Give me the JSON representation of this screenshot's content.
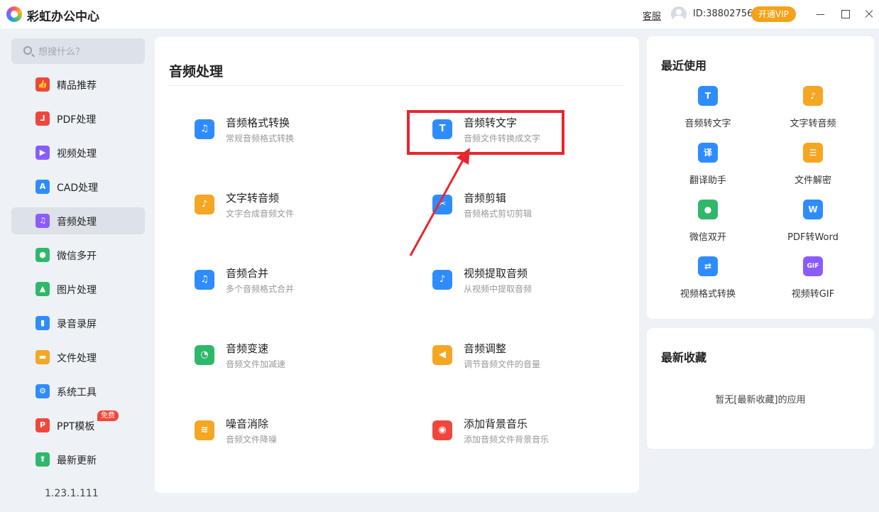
{
  "app": {
    "title": "彩虹办公中心",
    "service_label": "客服",
    "user_id": "ID:38802756",
    "vip_label": "开通VIP"
  },
  "search": {
    "placeholder": "想搜什么？"
  },
  "sidebar": {
    "items": [
      {
        "label": "精品推荐",
        "icon": "thumbs-up-icon",
        "color": "#f0473c"
      },
      {
        "label": "PDF处理",
        "icon": "pdf-icon",
        "color": "#f0473c"
      },
      {
        "label": "视频处理",
        "icon": "video-play-icon",
        "color": "#8a5cff"
      },
      {
        "label": "CAD处理",
        "icon": "cad-icon",
        "color": "#2f8cff"
      },
      {
        "label": "音频处理",
        "icon": "music-note-icon",
        "color": "#8a5cff"
      },
      {
        "label": "微信多开",
        "icon": "wechat-icon",
        "color": "#2fb86a"
      },
      {
        "label": "图片处理",
        "icon": "image-icon",
        "color": "#2fb86a"
      },
      {
        "label": "录音录屏",
        "icon": "microphone-icon",
        "color": "#2f8cff"
      },
      {
        "label": "文件处理",
        "icon": "folder-icon",
        "color": "#f5a623"
      },
      {
        "label": "系统工具",
        "icon": "gear-icon",
        "color": "#2f8cff"
      },
      {
        "label": "PPT模板",
        "icon": "ppt-icon",
        "color": "#f0473c",
        "badge": "免费"
      },
      {
        "label": "最新更新",
        "icon": "upload-icon",
        "color": "#2fb86a"
      }
    ],
    "version": "1.23.1.111"
  },
  "main": {
    "title": "音频处理",
    "tools": [
      {
        "name": "音频格式转换",
        "desc": "常规音频格式转换",
        "icon": "audio-convert-icon",
        "color": "#2f8cff"
      },
      {
        "name": "音频转文字",
        "desc": "音频文件转换成文字",
        "icon": "audio-to-text-icon",
        "color": "#2f8cff"
      },
      {
        "name": "文字转音频",
        "desc": "文字合成音频文件",
        "icon": "text-to-audio-icon",
        "color": "#f5a623"
      },
      {
        "name": "音频剪辑",
        "desc": "音频格式剪切剪辑",
        "icon": "audio-cut-icon",
        "color": "#2f8cff"
      },
      {
        "name": "音频合并",
        "desc": "多个音频格式合并",
        "icon": "audio-merge-icon",
        "color": "#2f8cff"
      },
      {
        "name": "视频提取音频",
        "desc": "从视频中提取音频",
        "icon": "audio-extract-icon",
        "color": "#2f8cff"
      },
      {
        "name": "音频变速",
        "desc": "音频文件加减速",
        "icon": "speed-gauge-icon",
        "color": "#2fb86a"
      },
      {
        "name": "音频调整",
        "desc": "调节音频文件的音量",
        "icon": "volume-icon",
        "color": "#f5a623"
      },
      {
        "name": "噪音消除",
        "desc": "音频文件降噪",
        "icon": "noise-wave-icon",
        "color": "#f5a623"
      },
      {
        "name": "添加背景音乐",
        "desc": "添加音频文件背景音乐",
        "icon": "background-music-icon",
        "color": "#f0473c"
      }
    ]
  },
  "recent": {
    "title": "最近使用",
    "items": [
      {
        "label": "音频转文字",
        "icon": "audio-to-text-icon",
        "color": "#2f8cff"
      },
      {
        "label": "文字转音频",
        "icon": "text-to-audio-icon",
        "color": "#f5a623"
      },
      {
        "label": "翻译助手",
        "icon": "translate-icon",
        "color": "#2f8cff"
      },
      {
        "label": "文件解密",
        "icon": "file-unlock-icon",
        "color": "#f5a623"
      },
      {
        "label": "微信双开",
        "icon": "wechat-icon",
        "color": "#2fb86a"
      },
      {
        "label": "PDF转Word",
        "icon": "pdf-to-word-icon",
        "color": "#2f8cff"
      },
      {
        "label": "视频格式转换",
        "icon": "video-convert-icon",
        "color": "#2f8cff"
      },
      {
        "label": "视频转GIF",
        "icon": "video-to-gif-icon",
        "color": "#8a5cff"
      }
    ]
  },
  "favorites": {
    "title": "最新收藏",
    "empty_text": "暂无[最新收藏]的应用"
  },
  "annotation": {
    "highlight_color": "#e8262e"
  }
}
